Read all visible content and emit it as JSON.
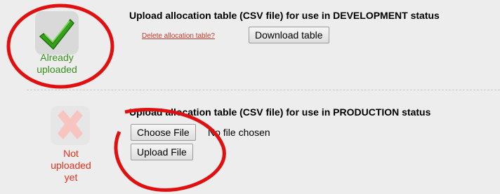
{
  "development": {
    "title": "Upload allocation table (CSV file) for use in DEVELOPMENT status",
    "status_text": "Already uploaded",
    "status_line1": "Already",
    "status_line2": "uploaded",
    "delete_link": "Delete allocation table?",
    "download_button": "Download table",
    "status_color": "#3a8f1f",
    "icon": "checkmark-icon"
  },
  "production": {
    "title": "Upload allocation table (CSV file) for use in PRODUCTION status",
    "status_line1": "Not",
    "status_line2": "uploaded",
    "status_line3": "yet",
    "choose_button": "Choose File",
    "file_status": "No file chosen",
    "upload_button": "Upload File",
    "status_color": "#e8301c",
    "icon": "x-mark-icon"
  },
  "annotation_color": "#e01010"
}
